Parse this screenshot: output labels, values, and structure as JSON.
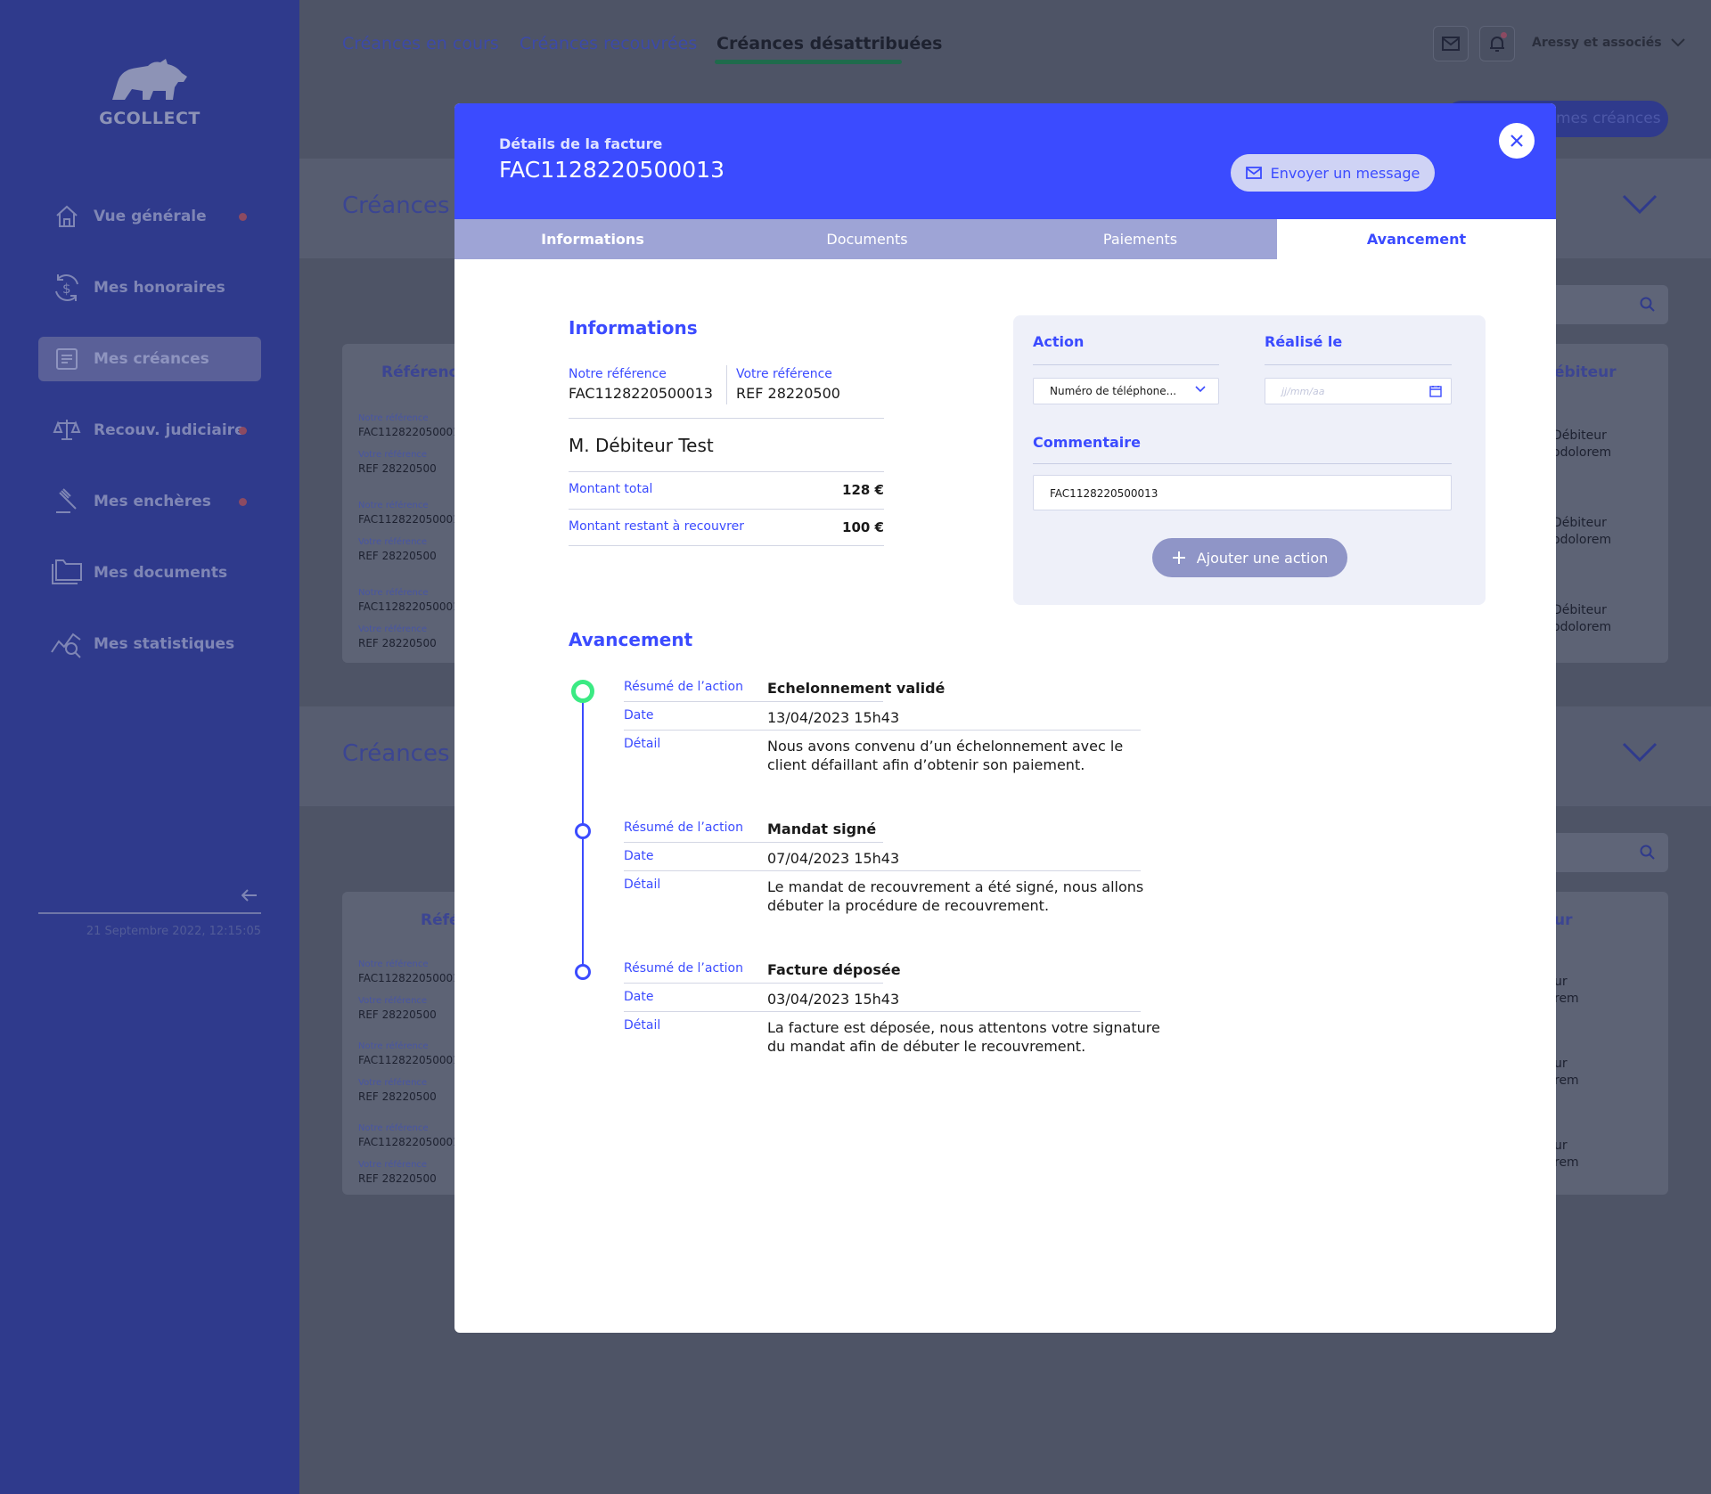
{
  "app": {
    "logo_text": "GCOLLECT"
  },
  "sidebar": {
    "items": [
      {
        "label": "Vue générale",
        "icon": "home-icon",
        "dot": true
      },
      {
        "label": "Mes honoraires",
        "icon": "fees-icon",
        "dot": false
      },
      {
        "label": "Mes créances",
        "icon": "document-list-icon",
        "dot": false,
        "active": true
      },
      {
        "label": "Recouv. judiciaire",
        "icon": "scale-icon",
        "dot": true
      },
      {
        "label": "Mes enchères",
        "icon": "gavel-icon",
        "dot": true
      },
      {
        "label": "Mes documents",
        "icon": "folder-icon",
        "dot": false
      },
      {
        "label": "Mes statistiques",
        "icon": "statistics-icon",
        "dot": false
      }
    ],
    "timestamp": "21 Septembre 2022, 12:15:05"
  },
  "topnav": {
    "tabs": [
      "Créances en cours",
      "Créances recouvrées",
      "Créances désattribuées"
    ],
    "active_tab": "Créances désattribuées",
    "company": "Aressy et associés"
  },
  "background": {
    "pill_label": "mes créances",
    "section1_title": "Créances a",
    "section2_title": "Créances d",
    "col_reference_1": "Référence",
    "col_reference_2": "Réfé",
    "col_debiteur_1": "ébiteur",
    "col_debiteur_2": "ur",
    "ref_label_notre": "Notre référence",
    "ref_label_votre": "Votre référence",
    "ref_value_notre": "FAC1128220500013",
    "ref_value_votre": "REF 28220500",
    "right_line1": "Débiteur",
    "right_line2": "odolorem",
    "right_line1_b": "ur",
    "right_line2_b": "rem"
  },
  "modal": {
    "subtitle": "Détails de la facture",
    "title": "FAC1128220500013",
    "send_message_label": "Envoyer un message",
    "tabs": [
      "Informations",
      "Documents",
      "Paiements",
      "Avancement"
    ],
    "active_tab": "Avancement",
    "info": {
      "section_title": "Informations",
      "notre_ref_label": "Notre référence",
      "notre_ref_value": "FAC1128220500013",
      "votre_ref_label": "Votre référence",
      "votre_ref_value": "REF 28220500",
      "debtor": "M. Débiteur Test",
      "total_label": "Montant total",
      "total_value": "128 €",
      "remaining_label": "Montant restant à recouvrer",
      "remaining_value": "100 €"
    },
    "action_form": {
      "action_label": "Action",
      "action_value": "Numéro de téléphone...",
      "date_label": "Réalisé le",
      "date_placeholder": "jj/mm/aa",
      "comment_label": "Commentaire",
      "comment_value": "FAC1128220500013",
      "add_button": "Ajouter une action"
    },
    "timeline": {
      "section_title": "Avancement",
      "summary_label": "Résumé de l’action",
      "date_label": "Date",
      "detail_label": "Détail",
      "entries": [
        {
          "summary": "Echelonnement validé",
          "date": "13/04/2023 15h43",
          "detail_line1": "Nous avons convenu d’un échelonnement avec le",
          "detail_line2": "client défaillant afin d’obtenir son paiement.",
          "current": true
        },
        {
          "summary": "Mandat signé",
          "date": "07/04/2023 15h43",
          "detail_line1": "Le mandat de recouvrement a été signé, nous allons",
          "detail_line2": "débuter la procédure de recouvrement.",
          "current": false
        },
        {
          "summary": "Facture déposée",
          "date": "03/04/2023 15h43",
          "detail_line1": "La facture est déposée, nous attentons votre signature",
          "detail_line2": "du mandat afin de débuter le recouvrement.",
          "current": false
        }
      ]
    }
  },
  "colors": {
    "primary": "#3b4bff",
    "sidebar": "#2f3a8c",
    "overlay": "#4e5466",
    "current_step": "#3bea83",
    "tab_inactive": "#9ea4d6"
  }
}
